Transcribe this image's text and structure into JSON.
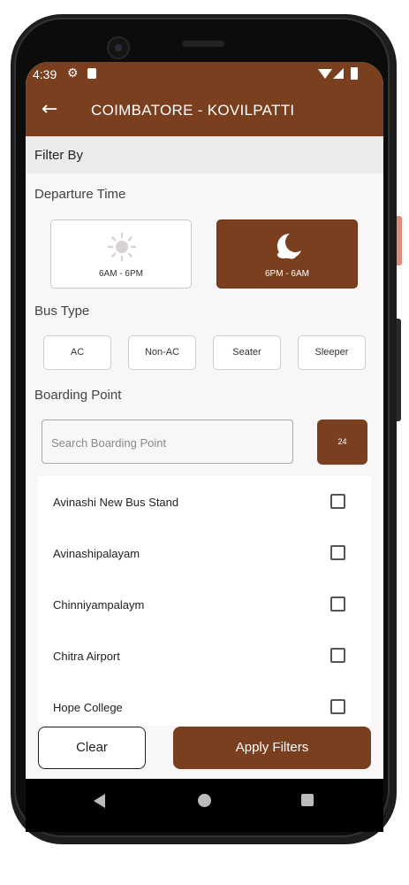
{
  "status_bar": {
    "time": "4:39",
    "icons": [
      "settings-icon",
      "sd-card-icon",
      "wifi-icon",
      "signal-icon",
      "battery-icon"
    ]
  },
  "app_bar": {
    "title": "COIMBATORE - KOVILPATTI",
    "back_icon": "arrow-left-icon"
  },
  "filter": {
    "heading": "Filter By",
    "departure_time": {
      "label": "Departure Time",
      "options": [
        {
          "label": "6AM - 6PM",
          "icon": "sun-icon",
          "selected": false
        },
        {
          "label": "6PM - 6AM",
          "icon": "moon-icon",
          "selected": true
        }
      ]
    },
    "bus_type": {
      "label": "Bus Type",
      "options": [
        "AC",
        "Non-AC",
        "Seater",
        "Sleeper"
      ]
    },
    "boarding_point": {
      "label": "Boarding Point",
      "search_placeholder": "Search Boarding Point",
      "search_value": "",
      "count": "24",
      "items": [
        {
          "name": "Avinashi New Bus Stand",
          "checked": false
        },
        {
          "name": "Avinashipalayam",
          "checked": false
        },
        {
          "name": "Chinniyampalaym",
          "checked": false
        },
        {
          "name": "Chitra Airport",
          "checked": false
        },
        {
          "name": "Hope College",
          "checked": false
        }
      ]
    }
  },
  "actions": {
    "clear_label": "Clear",
    "apply_label": "Apply Filters"
  },
  "colors": {
    "primary": "#7a3f1e",
    "background": "#f8f6f6",
    "section_bg": "#ebebeb"
  }
}
